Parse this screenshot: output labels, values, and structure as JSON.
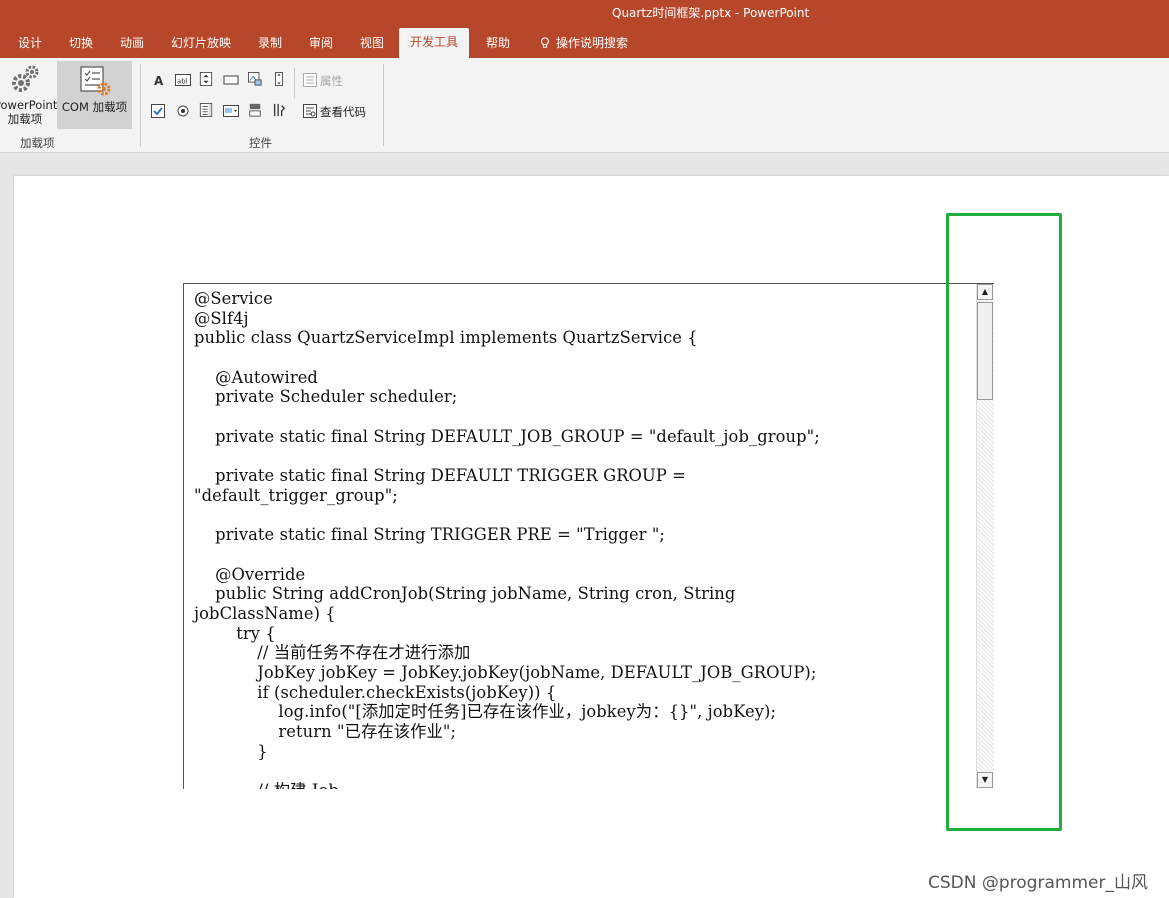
{
  "window": {
    "title": "Quartz时间框架.pptx  -  PowerPoint"
  },
  "ribbon_tabs": [
    {
      "label": "设计"
    },
    {
      "label": "切换"
    },
    {
      "label": "动画"
    },
    {
      "label": "幻灯片放映"
    },
    {
      "label": "录制"
    },
    {
      "label": "审阅"
    },
    {
      "label": "视图"
    },
    {
      "label": "开发工具",
      "active": true
    },
    {
      "label": "帮助"
    },
    {
      "label": "操作说明搜索",
      "icon": "lightbulb-icon"
    }
  ],
  "addins_group": {
    "powerpoint_addins_label_1": "PowerPoint",
    "powerpoint_addins_label_2": "加载项",
    "com_addins_label": "COM 加载项",
    "group_label": "加载项"
  },
  "controls_group": {
    "properties_label": "属性",
    "view_code_label": "查看代码",
    "group_label": "控件",
    "icons": [
      "label-control-icon",
      "textbox-control-icon",
      "spin-button-icon",
      "command-button-icon",
      "image-control-icon",
      "scrollbar-icon",
      "checkbox-icon",
      "option-button-icon",
      "listbox-icon",
      "combobox-icon",
      "toggle-button-icon",
      "more-controls-icon"
    ]
  },
  "code_box": {
    "lines": [
      "@Service",
      "@Slf4j",
      "public class QuartzServiceImpl implements QuartzService {",
      "",
      "    @Autowired",
      "    private Scheduler scheduler;",
      "",
      "    private static final String DEFAULT_JOB_GROUP = \"default_job_group\";",
      "",
      "    private static final String DEFAULT TRIGGER GROUP =",
      "\"default_trigger_group\";",
      "",
      "    private static final String TRIGGER PRE = \"Trigger \";",
      "",
      "    @Override",
      "    public String addCronJob(String jobName, String cron, String",
      "jobClassName) {",
      "        try {",
      "            // 当前任务不存在才进行添加",
      "            JobKey jobKey = JobKey.jobKey(jobName, DEFAULT_JOB_GROUP);",
      "            if (scheduler.checkExists(jobKey)) {",
      "                log.info(\"[添加定时任务]已存在该作业，jobkey为：{}\", jobKey);",
      "                return \"已存在该作业\";",
      "            }",
      "",
      "            // 构建 Job"
    ]
  },
  "scrollbar": {
    "up_glyph": "▲",
    "down_glyph": "▼",
    "position": 0.05
  },
  "annotation": {
    "color": "#1fae3b"
  },
  "watermark": "CSDN @programmer_山风",
  "colors": {
    "accent": "#b7472a",
    "ribbon_bg": "#f3f3f3"
  }
}
